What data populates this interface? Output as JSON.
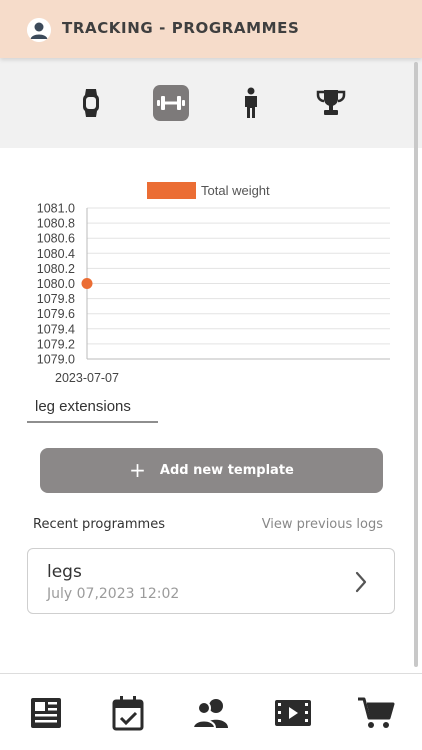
{
  "header": {
    "title": "TRACKING - PROGRAMMES"
  },
  "tabs": [
    {
      "icon": "watch-icon",
      "active": false
    },
    {
      "icon": "dumbbell-icon",
      "active": true
    },
    {
      "icon": "person-icon",
      "active": false
    },
    {
      "icon": "trophy-icon",
      "active": false
    }
  ],
  "chart_data": {
    "type": "line",
    "x": [
      "2023-07-07"
    ],
    "series": [
      {
        "name": "Total weight",
        "values": [
          1080.0
        ],
        "color": "#eb6d34"
      }
    ],
    "yticks": [
      "1081.0",
      "1080.8",
      "1080.6",
      "1080.4",
      "1080.2",
      "1080.0",
      "1079.8",
      "1079.6",
      "1079.4",
      "1079.2",
      "1079.0"
    ],
    "ylim": [
      1079.0,
      1081.0
    ],
    "grid": true,
    "legend": "top-center"
  },
  "exercise": {
    "selected": "leg extensions"
  },
  "add_template": {
    "label": "Add new template"
  },
  "recent": {
    "label": "Recent programmes",
    "view_previous": "View previous logs",
    "items": [
      {
        "name": "legs",
        "date": "July 07,2023 12:02"
      }
    ]
  },
  "bottom_nav": [
    {
      "icon": "newspaper-icon"
    },
    {
      "icon": "calendar-check-icon"
    },
    {
      "icon": "users-icon"
    },
    {
      "icon": "film-icon"
    },
    {
      "icon": "cart-icon"
    }
  ],
  "colors": {
    "accent": "#eb6d34",
    "header_bg": "#f6dcca",
    "button_bg": "#8b8888",
    "active_tab": "#7d7a7a"
  }
}
